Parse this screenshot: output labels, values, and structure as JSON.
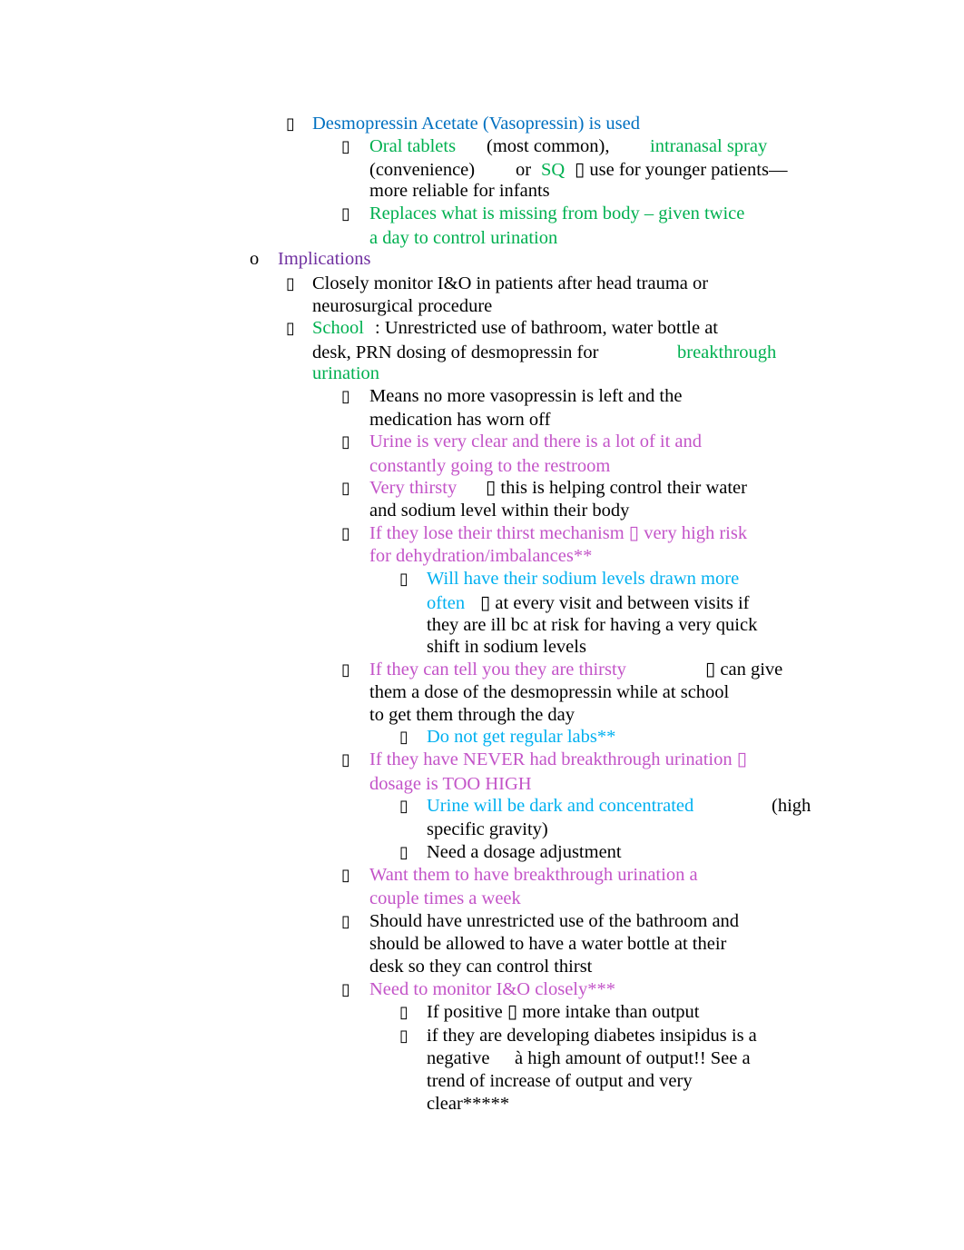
{
  "colors": {
    "black": "#000000",
    "blue": "#0070c0",
    "green": "#00b050",
    "purple": "#7030a0",
    "pink": "#c354c8",
    "cyan": "#00b0f0"
  },
  "lines": [
    {
      "bullet": "▯",
      "segments": [
        {
          "text": "Desmopressin Acetate (Vasopressin) is used",
          "color": "blue"
        }
      ]
    },
    {
      "bullet": "▯",
      "segments": [
        {
          "text": "Oral tablets",
          "color": "green"
        },
        {
          "text": "(most common),",
          "color": "black"
        },
        {
          "text": "intranasal spray",
          "color": "green"
        }
      ]
    },
    {
      "segments": [
        {
          "text": "(convenience)",
          "color": "black"
        },
        {
          "text": "or",
          "color": "black"
        },
        {
          "text": "SQ",
          "color": "green"
        },
        {
          "text": "▯ use for younger patients—",
          "color": "black"
        }
      ]
    },
    {
      "segments": [
        {
          "text": "more reliable for infants",
          "color": "black"
        }
      ]
    },
    {
      "bullet": "▯",
      "segments": [
        {
          "text": "Replaces what is missing from body – given twice",
          "color": "green"
        }
      ]
    },
    {
      "segments": [
        {
          "text": "a day to control urination",
          "color": "green"
        }
      ]
    },
    {
      "bullet": "o",
      "segments": [
        {
          "text": "Implications",
          "color": "purple"
        }
      ]
    },
    {
      "bullet": "▯",
      "segments": [
        {
          "text": "Closely monitor I&O in patients after head trauma or",
          "color": "black"
        }
      ]
    },
    {
      "segments": [
        {
          "text": "neurosurgical procedure",
          "color": "black"
        }
      ]
    },
    {
      "bullet": "▯",
      "segments": [
        {
          "text": "School",
          "color": "green"
        },
        {
          "text": ": Unrestricted use of bathroom, water bottle at",
          "color": "black"
        }
      ]
    },
    {
      "segments": [
        {
          "text": "desk, PRN dosing of desmopressin for",
          "color": "black"
        },
        {
          "text": "breakthrough",
          "color": "green"
        }
      ]
    },
    {
      "segments": [
        {
          "text": "urination",
          "color": "green"
        }
      ]
    },
    {
      "bullet": "▯",
      "segments": [
        {
          "text": "Means no more vasopressin is left and the",
          "color": "black"
        }
      ]
    },
    {
      "segments": [
        {
          "text": "medication has worn off",
          "color": "black"
        }
      ]
    },
    {
      "bullet": "▯",
      "segments": [
        {
          "text": "Urine is very clear and there is a lot of it and",
          "color": "pink"
        }
      ]
    },
    {
      "segments": [
        {
          "text": "constantly going to the restroom",
          "color": "pink"
        }
      ]
    },
    {
      "bullet": "▯",
      "segments": [
        {
          "text": "Very thirsty",
          "color": "pink"
        },
        {
          "text": "▯ this is helping control their water",
          "color": "black"
        }
      ]
    },
    {
      "segments": [
        {
          "text": "and sodium level within their body",
          "color": "black"
        }
      ]
    },
    {
      "bullet": "▯",
      "segments": [
        {
          "text": "If they lose their thirst mechanism ▯ very high risk",
          "color": "pink"
        }
      ]
    },
    {
      "segments": [
        {
          "text": "for dehydration/imbalances**",
          "color": "pink"
        }
      ]
    },
    {
      "bullet": "▯",
      "segments": [
        {
          "text": "Will have their sodium levels drawn more",
          "color": "cyan"
        }
      ]
    },
    {
      "segments": [
        {
          "text": "often",
          "color": "cyan"
        },
        {
          "text": "▯ at every visit and between visits if",
          "color": "black"
        }
      ]
    },
    {
      "segments": [
        {
          "text": "they are ill bc at risk for having a very quick",
          "color": "black"
        }
      ]
    },
    {
      "segments": [
        {
          "text": "shift in sodium levels",
          "color": "black"
        }
      ]
    },
    {
      "bullet": "▯",
      "segments": [
        {
          "text": "If they can tell you they are thirsty",
          "color": "pink"
        },
        {
          "text": "▯ can give",
          "color": "black"
        }
      ]
    },
    {
      "segments": [
        {
          "text": "them a dose of the desmopressin while at school",
          "color": "black"
        }
      ]
    },
    {
      "segments": [
        {
          "text": "to get them through the day",
          "color": "black"
        }
      ]
    },
    {
      "bullet": "▯",
      "segments": [
        {
          "text": "Do not get regular labs**",
          "color": "cyan"
        }
      ]
    },
    {
      "bullet": "▯",
      "segments": [
        {
          "text": "If they have NEVER had breakthrough urination ▯",
          "color": "pink"
        }
      ]
    },
    {
      "segments": [
        {
          "text": "dosage is TOO HIGH",
          "color": "pink"
        }
      ]
    },
    {
      "bullet": "▯",
      "segments": [
        {
          "text": "Urine will be dark and concentrated",
          "color": "cyan"
        },
        {
          "text": "(high",
          "color": "black"
        }
      ]
    },
    {
      "segments": [
        {
          "text": "specific gravity)",
          "color": "black"
        }
      ]
    },
    {
      "bullet": "▯",
      "segments": [
        {
          "text": "Need a dosage adjustment",
          "color": "black"
        }
      ]
    },
    {
      "bullet": "▯",
      "segments": [
        {
          "text": "Want them to have breakthrough urination a",
          "color": "pink"
        }
      ]
    },
    {
      "segments": [
        {
          "text": "couple times a week",
          "color": "pink"
        }
      ]
    },
    {
      "bullet": "▯",
      "segments": [
        {
          "text": "Should have unrestricted use of the bathroom and",
          "color": "black"
        }
      ]
    },
    {
      "segments": [
        {
          "text": "should be allowed to have a water bottle at their",
          "color": "black"
        }
      ]
    },
    {
      "segments": [
        {
          "text": "desk so they can control thirst",
          "color": "black"
        }
      ]
    },
    {
      "bullet": "▯",
      "segments": [
        {
          "text": "Need to monitor I&O closely***",
          "color": "pink"
        }
      ]
    },
    {
      "bullet": "▯",
      "segments": [
        {
          "text": "If positive ▯ more intake than output",
          "color": "black"
        }
      ]
    },
    {
      "bullet": "▯",
      "segments": [
        {
          "text": "if they are developing diabetes insipidus is a",
          "color": "black"
        }
      ]
    },
    {
      "segments": [
        {
          "text": "negative",
          "color": "black"
        },
        {
          "text": "à high amount of output!! See a",
          "color": "black"
        }
      ]
    },
    {
      "segments": [
        {
          "text": "trend of increase of output and very",
          "color": "black"
        }
      ]
    },
    {
      "segments": [
        {
          "text": "clear*****",
          "color": "black"
        }
      ]
    }
  ]
}
